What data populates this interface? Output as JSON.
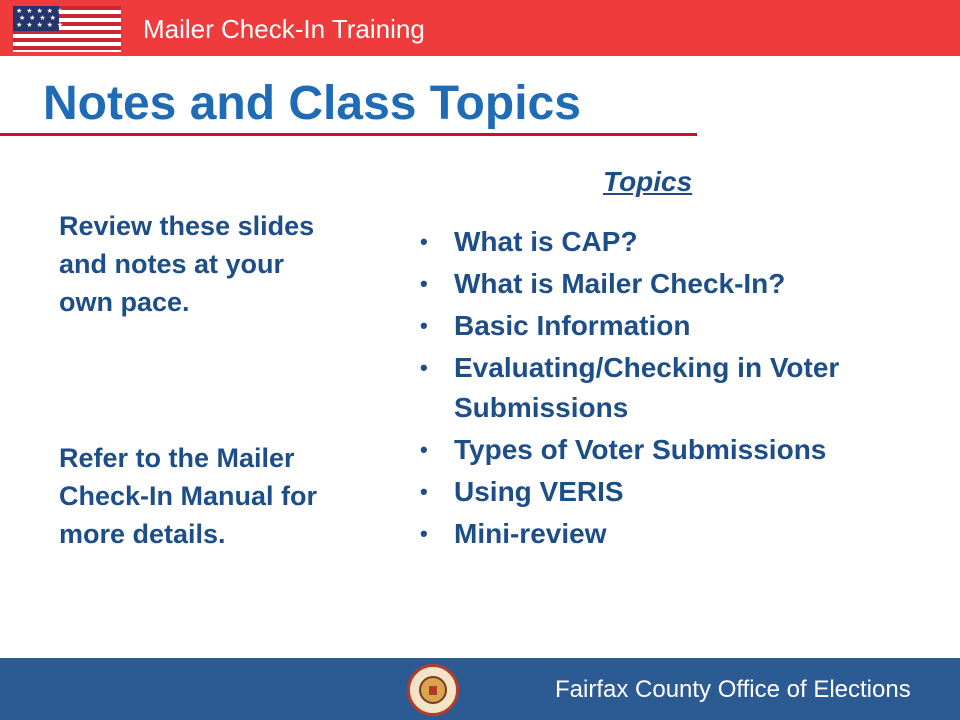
{
  "header": {
    "title": "Mailer Check-In Training",
    "flag_stars": "★ ★ ★ ★ ★\n ★ ★ ★ ★\n★ ★ ★ ★ ★"
  },
  "page_title": "Notes and Class Topics",
  "left_notes": [
    "Review these slides and notes at your own pace.",
    "Refer to the Mailer Check-In Manual for more details."
  ],
  "topics": {
    "heading": "Topics",
    "bullet": "•",
    "items": [
      "What is CAP?",
      "What is Mailer Check-In?",
      "Basic Information",
      "Evaluating/Checking in Voter Submissions",
      "Types of Voter Submissions",
      "Using VERIS",
      "Mini-review"
    ]
  },
  "footer": {
    "organization": "Fairfax County Office of Elections"
  },
  "colors": {
    "header_red": "#ef3b3b",
    "title_blue": "#1f6bb5",
    "text_navy": "#1d4e87",
    "footer_blue": "#2c5b94",
    "rule_red": "#c8102e"
  },
  "icons": {
    "flag": "us-flag-icon",
    "seal": "county-seal-icon"
  }
}
